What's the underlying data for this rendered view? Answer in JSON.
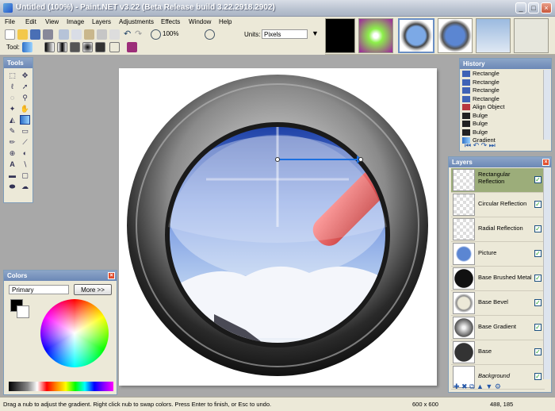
{
  "window": {
    "title": "Untitled (100%) - Paint.NET v3.22 (Beta Release build 3.22.2918.2902)"
  },
  "menu": [
    "File",
    "Edit",
    "View",
    "Image",
    "Layers",
    "Adjustments",
    "Effects",
    "Window",
    "Help"
  ],
  "toolbar": {
    "zoom": "100%",
    "units_label": "Units:",
    "units_value": "Pixels",
    "tool_label": "Tool:"
  },
  "tools_panel": {
    "title": "Tools"
  },
  "history_panel": {
    "title": "History",
    "items": [
      "Rectangle",
      "Rectangle",
      "Rectangle",
      "Rectangle",
      "Align Object",
      "Bulge",
      "Bulge",
      "Bulge",
      "Gradient"
    ]
  },
  "layers_panel": {
    "title": "Layers",
    "items": [
      {
        "name": "Rectangular Reflection",
        "checked": true
      },
      {
        "name": "Circular Reflection",
        "checked": true
      },
      {
        "name": "Radial Reflection",
        "checked": true
      },
      {
        "name": "Picture",
        "checked": true
      },
      {
        "name": "Base Brushed Metal",
        "checked": true
      },
      {
        "name": "Base Bevel",
        "checked": true
      },
      {
        "name": "Base Gradient",
        "checked": true
      },
      {
        "name": "Base",
        "checked": true
      },
      {
        "name": "Background",
        "checked": true
      }
    ]
  },
  "colors_panel": {
    "title": "Colors",
    "mode": "Primary",
    "more_label": "More >>"
  },
  "status": {
    "message": "Drag a nub to adjust the gradient. Right click nub to swap colors. Press Enter to finish, or Esc to undo.",
    "size": "600 x 600",
    "coords": "488, 185"
  }
}
